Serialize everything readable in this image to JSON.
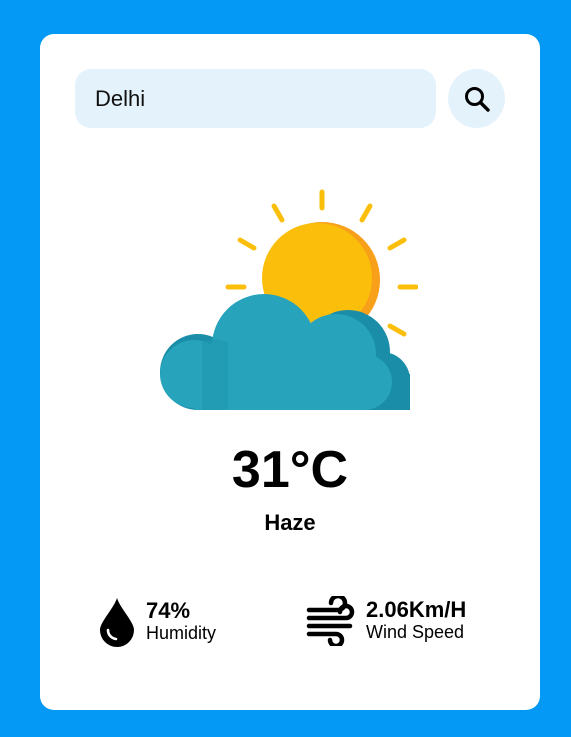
{
  "search": {
    "value": "Delhi",
    "placeholder": "Enter city name"
  },
  "weather": {
    "icon": "sun-behind-cloud-icon",
    "temperature": "31°C",
    "condition": "Haze"
  },
  "details": {
    "humidity": {
      "value": "74%",
      "label": "Humidity",
      "icon": "water-drop-icon"
    },
    "wind": {
      "value": "2.06Km/H",
      "label": "Wind Speed",
      "icon": "wind-icon"
    }
  },
  "colors": {
    "background": "#0399f4",
    "card": "#ffffff",
    "input_bg": "#e4f3fb",
    "sun": "#fbbf0b",
    "sun_shade": "#f9a01b",
    "cloud": "#27a3bb",
    "cloud_shade": "#1a8ea8"
  }
}
